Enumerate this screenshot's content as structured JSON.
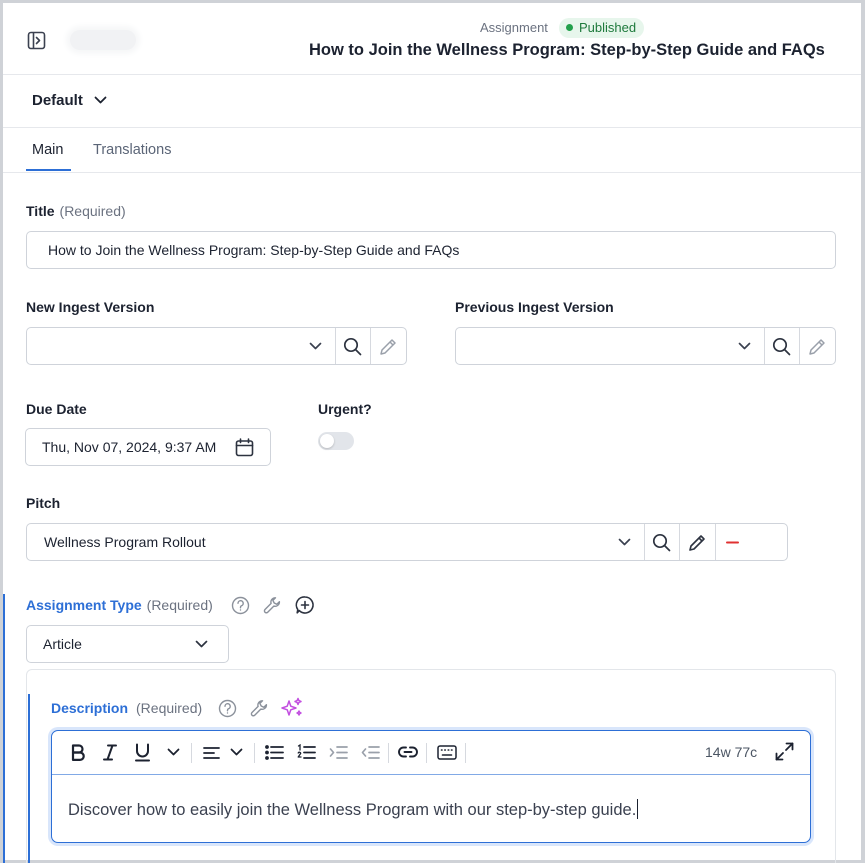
{
  "header": {
    "kind": "Assignment",
    "status": "Published",
    "title": "How to Join the Wellness Program: Step-by-Step Guide and FAQs"
  },
  "profile": {
    "label": "Default"
  },
  "tabs": [
    {
      "label": "Main",
      "active": true
    },
    {
      "label": "Translations",
      "active": false
    }
  ],
  "fields": {
    "title": {
      "label": "Title",
      "required": "(Required)",
      "value": "How to Join the Wellness Program: Step-by-Step Guide and FAQs"
    },
    "new_ingest": {
      "label": "New Ingest Version",
      "value": ""
    },
    "prev_ingest": {
      "label": "Previous Ingest Version",
      "value": ""
    },
    "due_date": {
      "label": "Due Date",
      "value": "Thu, Nov 07, 2024, 9:37 AM"
    },
    "urgent": {
      "label": "Urgent?",
      "checked": false
    },
    "pitch": {
      "label": "Pitch",
      "value": "Wellness Program Rollout"
    },
    "assignment_type": {
      "label": "Assignment Type",
      "required": "(Required)",
      "value": "Article"
    },
    "description": {
      "label": "Description",
      "required": "(Required)",
      "counter": "14w 77c",
      "text": "Discover how to easily join the Wellness Program with our step-by-step guide."
    }
  },
  "colors": {
    "accent": "#2d6fd6",
    "published_bg": "#e7f6ec",
    "published_text": "#1e7a3c",
    "remove": "#e03131",
    "sparkle": "#c24ee0"
  },
  "icons": [
    "sidebar-toggle-icon",
    "chevron-down-icon",
    "search-icon",
    "pencil-icon",
    "calendar-icon",
    "minus-icon",
    "help-icon",
    "wrench-icon",
    "add-comment-icon",
    "sparkle-icon",
    "bold-icon",
    "italic-icon",
    "underline-icon",
    "align-icon",
    "bullet-list-icon",
    "numbered-list-icon",
    "indent-icon",
    "outdent-icon",
    "link-icon",
    "keyboard-icon",
    "expand-icon"
  ]
}
